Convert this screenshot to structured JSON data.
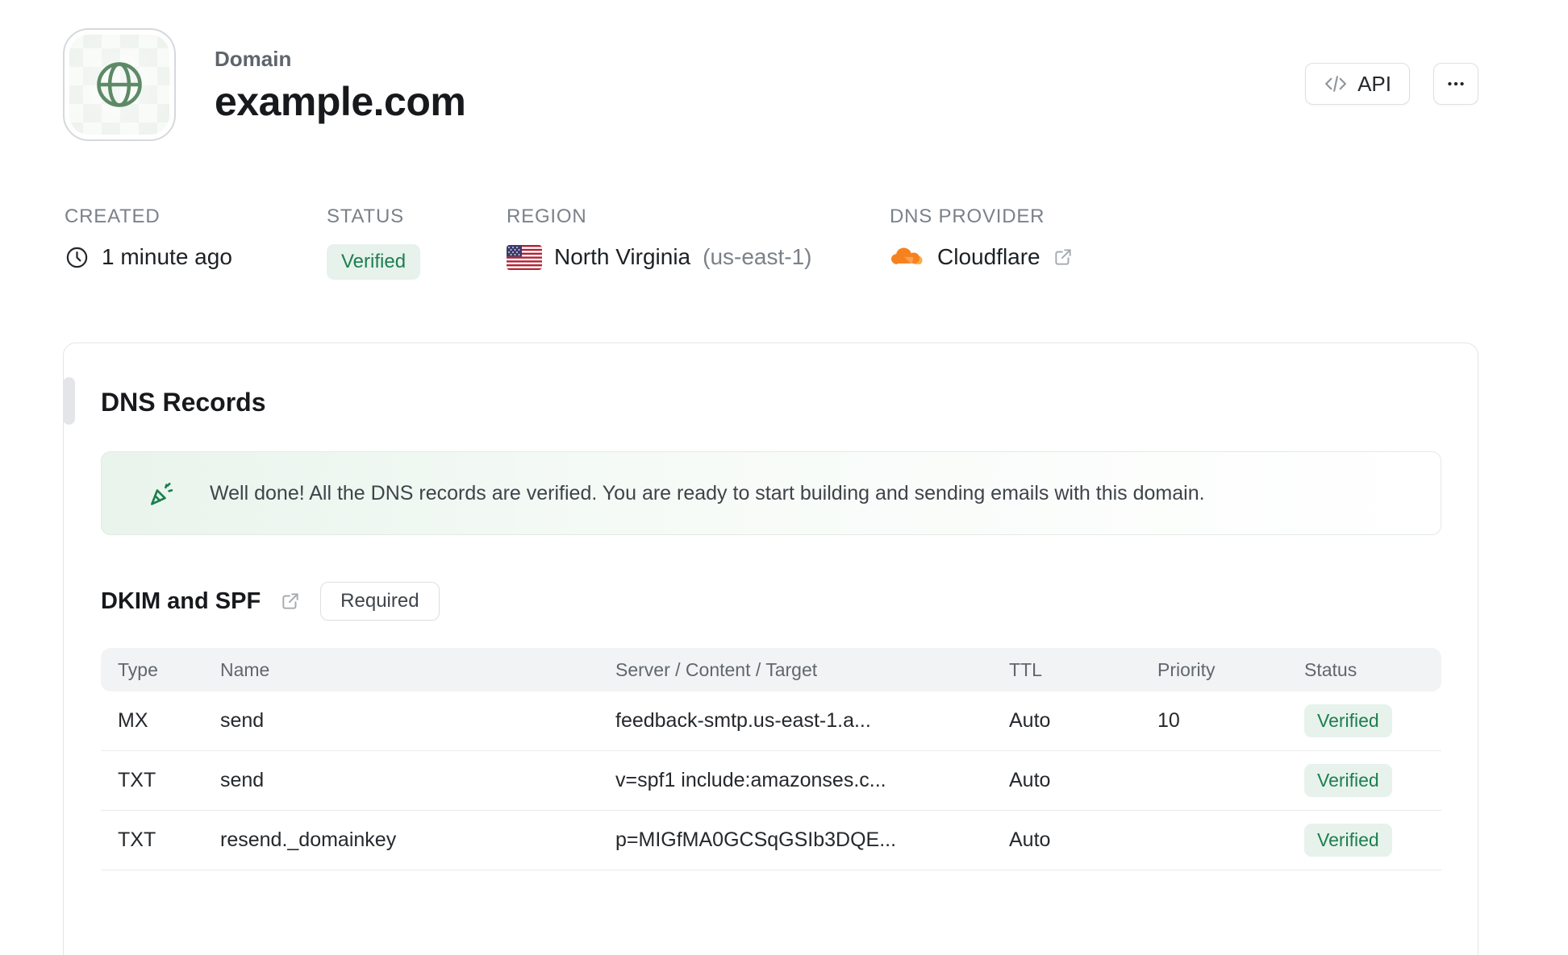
{
  "header": {
    "label": "Domain",
    "title": "example.com",
    "api_button_label": "API"
  },
  "meta": {
    "created": {
      "label": "CREATED",
      "value": "1 minute ago"
    },
    "status": {
      "label": "STATUS",
      "value": "Verified"
    },
    "region": {
      "label": "REGION",
      "name": "North Virginia",
      "code": "(us-east-1)"
    },
    "dns_provider": {
      "label": "DNS PROVIDER",
      "value": "Cloudflare"
    }
  },
  "dns_records": {
    "title": "DNS Records",
    "banner_text": "Well done! All the DNS records are verified. You are ready to start building and sending emails with this domain.",
    "section": {
      "title": "DKIM and SPF",
      "badge": "Required"
    },
    "table": {
      "headers": [
        "Type",
        "Name",
        "Server / Content / Target",
        "TTL",
        "Priority",
        "Status"
      ],
      "rows": [
        {
          "type": "MX",
          "name": "send",
          "content": "feedback-smtp.us-east-1.a...",
          "ttl": "Auto",
          "priority": "10",
          "status": "Verified"
        },
        {
          "type": "TXT",
          "name": "send",
          "content": "v=spf1 include:amazonses.c...",
          "ttl": "Auto",
          "priority": "",
          "status": "Verified"
        },
        {
          "type": "TXT",
          "name": "resend._domainkey",
          "content": "p=MIGfMA0GCSqGSIb3DQE...",
          "ttl": "Auto",
          "priority": "",
          "status": "Verified"
        }
      ]
    }
  },
  "colors": {
    "accent_green": "#1d7f4f",
    "badge_green_bg": "#e7f2ec",
    "cloudflare_orange": "#f6821f",
    "cloudflare_orange_light": "#fbad41",
    "text_dark": "#17191c",
    "text_gray": "#7b8188",
    "border": "#e2e5e8"
  }
}
